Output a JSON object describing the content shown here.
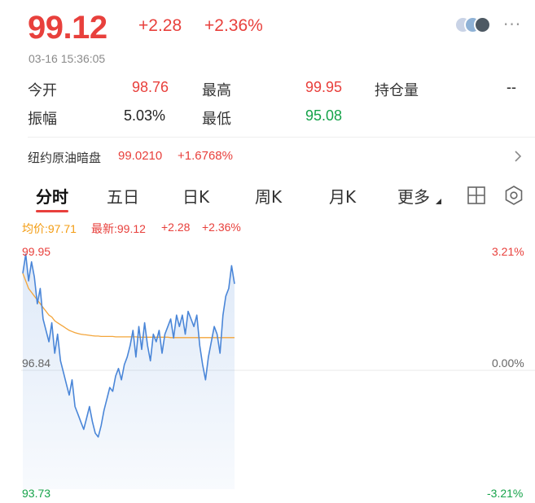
{
  "quote": {
    "price": "99.12",
    "change": "+2.28",
    "change_pct": "+2.36%",
    "timestamp": "03-16 15:36:05"
  },
  "stats": {
    "open_label": "今开",
    "open_value": "98.76",
    "high_label": "最高",
    "high_value": "99.95",
    "oi_label": "持仓量",
    "oi_value": "--",
    "amp_label": "振幅",
    "amp_value": "5.03%",
    "low_label": "最低",
    "low_value": "95.08"
  },
  "crude": {
    "label": "纽约原油暗盘",
    "price": "99.0210",
    "change_pct": "+1.6768%"
  },
  "tabs": [
    "分时",
    "五日",
    "日K",
    "周K",
    "月K",
    "更多"
  ],
  "legend": {
    "avg": "均价:97.71",
    "latest": "最新:99.12",
    "change": "+2.28",
    "change_pct": "+2.36%"
  },
  "axis": {
    "left_top": "99.95",
    "left_mid": "96.84",
    "left_bottom": "93.73",
    "right_top": "3.21%",
    "right_mid": "0.00%",
    "right_bottom": "-3.21%"
  },
  "icons": {
    "more": "more-dots-icon",
    "arrow": "chevron-right-icon",
    "grid": "grid-icon",
    "settings": "settings-icon"
  },
  "colors": {
    "up": "#e8403c",
    "down": "#16a34a",
    "avg_line": "#f3a53a",
    "price_line": "#4a86d8"
  },
  "chart_data": {
    "type": "line",
    "ylim": [
      93.73,
      99.95
    ],
    "reference": 96.84,
    "series": [
      {
        "values": [
          99.4,
          99.9,
          99.2,
          99.7,
          99.3,
          98.6,
          99.0,
          98.2,
          97.9,
          97.6,
          98.1,
          97.3,
          97.8,
          97.1,
          96.8,
          96.5,
          96.2,
          96.6,
          95.9,
          95.7,
          95.5,
          95.3,
          95.6,
          95.9,
          95.5,
          95.2,
          95.1,
          95.4,
          95.8,
          96.1,
          96.4,
          96.3,
          96.7,
          96.9,
          96.6,
          97.0,
          97.2,
          97.5,
          97.9,
          97.2,
          98.0,
          97.4,
          98.1,
          97.5,
          97.1,
          97.8,
          97.6,
          97.9,
          97.3,
          97.8,
          98.0,
          98.2,
          97.7,
          98.3,
          98.0,
          98.3,
          97.8,
          98.4,
          98.2,
          98.0,
          98.3,
          97.5,
          97.0,
          96.6,
          97.2,
          97.6,
          98.0,
          97.8,
          97.3,
          98.3,
          98.8,
          99.0,
          99.6,
          99.12
        ]
      },
      {
        "values": [
          99.4,
          99.2,
          99.0,
          98.9,
          98.8,
          98.7,
          98.6,
          98.5,
          98.4,
          98.3,
          98.25,
          98.15,
          98.1,
          98.05,
          98.0,
          97.95,
          97.9,
          97.87,
          97.84,
          97.82,
          97.8,
          97.79,
          97.78,
          97.77,
          97.76,
          97.75,
          97.75,
          97.74,
          97.74,
          97.74,
          97.74,
          97.74,
          97.73,
          97.73,
          97.73,
          97.73,
          97.73,
          97.73,
          97.73,
          97.73,
          97.72,
          97.72,
          97.72,
          97.72,
          97.72,
          97.72,
          97.72,
          97.72,
          97.72,
          97.72,
          97.72,
          97.71,
          97.71,
          97.71,
          97.71,
          97.71,
          97.71,
          97.71,
          97.71,
          97.71,
          97.71,
          97.71,
          97.71,
          97.71,
          97.71,
          97.71,
          97.71,
          97.71,
          97.71,
          97.71,
          97.71,
          97.71,
          97.71,
          97.71
        ]
      }
    ]
  }
}
